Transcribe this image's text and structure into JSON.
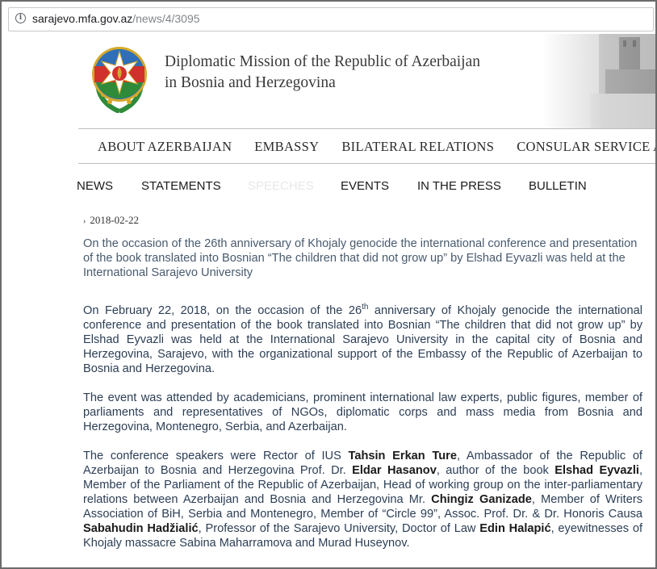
{
  "browser": {
    "url_domain": "sarajevo.mfa.gov.az",
    "url_path": "/news/4/3095"
  },
  "header": {
    "title_line1": "Diplomatic Mission of the Republic of Azerbaijan",
    "title_line2": "in Bosnia and Herzegovina"
  },
  "top_nav": [
    "ABOUT AZERBAIJAN",
    "EMBASSY",
    "BILATERAL RELATIONS",
    "CONSULAR SERVICE A"
  ],
  "sub_nav": {
    "news": "NEWS",
    "statements": "STATEMENTS",
    "speeches": "SPEECHES",
    "events": "EVENTS",
    "in_the_press": "IN THE PRESS",
    "bulletin": "BULLETIN"
  },
  "article": {
    "date": "2018-02-22",
    "headline": "On the occasion of the 26th anniversary of Khojaly genocide the international conference and presentation of the book translated into Bosnian “The children that did not grow up” by Elshad Eyvazli was held at the International Sarajevo University",
    "p1_a": "On February 22, 2018, on the occasion of the 26",
    "p1_sup": "th",
    "p1_b": " anniversary of Khojaly genocide the international conference and presentation of the book translated into Bosnian “The children that did not grow up” by Elshad Eyvazli was held at the International Sarajevo University in the capital city of Bosnia and Herzegovina, Sarajevo, with the organizational support of the Embassy of the Republic of Azerbaijan to Bosnia and Herzegovina.",
    "p2": "The event was attended by academicians, prominent international law experts, public figures, member of parliaments and representatives of NGOs, diplomatic corps and mass media from Bosnia and Herzegovina, Montenegro, Serbia, and Azerbaijan.",
    "p3": {
      "t1": "The conference speakers were Rector of IUS ",
      "b1": "Tahsin Erkan Ture",
      "t2": ", Ambassador of the Republic of Azerbaijan to Bosnia and Herzegovina Prof. Dr. ",
      "b2": "Eldar Hasanov",
      "t3": ", author of the book ",
      "b3": "Elshad Eyvazli",
      "t4": ", Member of the Parliament of the Republic of Azerbaijan, Head of working group on the inter-parliamentary relations between Azerbaijan and Bosnia and Herzegovina Mr. ",
      "b4": "Chingiz Ganizade",
      "t5": ", Member of Writers Association of BiH, Serbia and Montenegro, Member of “Circle 99”, Assoc. Prof. Dr. & Dr. Honoris Causa ",
      "b5": "Sabahudin Hadžialić",
      "t6": ", Professor of the Sarajevo University, Doctor of Law ",
      "b6": "Edin Halapić",
      "t7": ", eyewitnesses of Khojaly massacre Sabina Maharramova and Murad Huseynov."
    }
  },
  "colors": {
    "headline": "#485a6e",
    "body_text": "#2c3e55",
    "emblem_blue": "#2f6fb7",
    "emblem_red": "#d0312d",
    "emblem_green": "#2f8b3a",
    "emblem_gold": "#d6a82a"
  }
}
